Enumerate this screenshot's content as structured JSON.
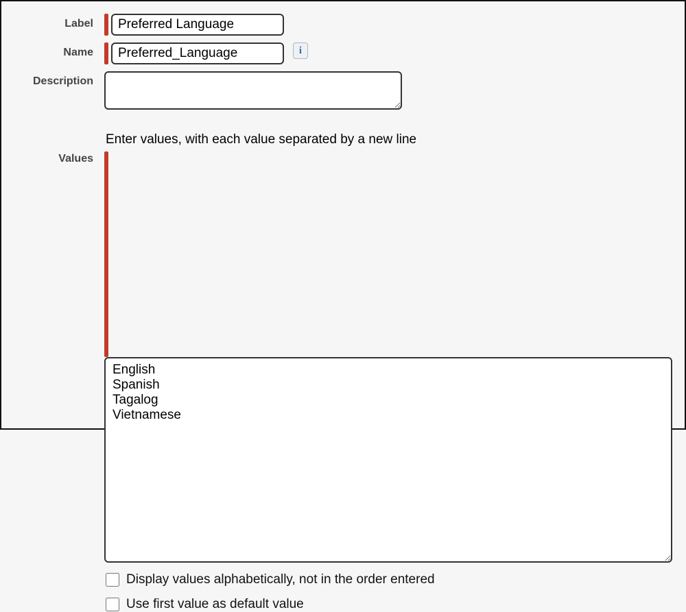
{
  "form": {
    "label_field": {
      "label": "Label",
      "value": "Preferred Language"
    },
    "name_field": {
      "label": "Name",
      "value": "Preferred_Language"
    },
    "description_field": {
      "label": "Description",
      "value": ""
    },
    "values_field": {
      "label": "Values",
      "hint": "Enter values, with each value separated by a new line",
      "value": "English\nSpanish\nTagalog\nVietnamese"
    },
    "options": {
      "alpha_sort": {
        "label": "Display values alphabetically, not in the order entered",
        "checked": false
      },
      "first_default": {
        "label": "Use first value as default value",
        "checked": false
      }
    },
    "info_glyph": "i"
  }
}
